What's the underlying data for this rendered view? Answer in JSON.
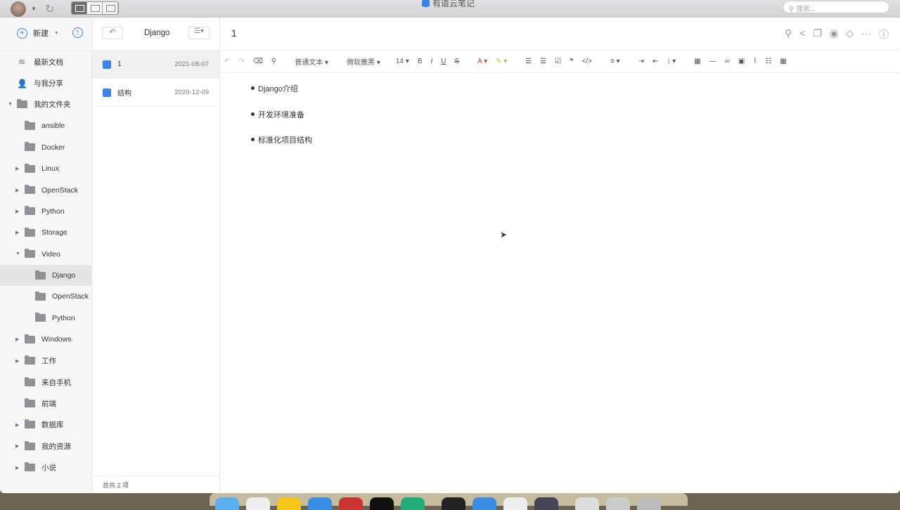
{
  "app": {
    "title": "有道云笔记",
    "search_placeholder": "搜索..."
  },
  "sidebar": {
    "new_label": "新建",
    "items": [
      {
        "label": "最新文档",
        "type": "nav",
        "icon": "layers-icon"
      },
      {
        "label": "与我分享",
        "type": "nav",
        "icon": "share-user-icon"
      },
      {
        "label": "我的文件夹",
        "type": "root",
        "expanded": true
      },
      {
        "label": "ansible",
        "level": 1
      },
      {
        "label": "Docker",
        "level": 1
      },
      {
        "label": "Linux",
        "level": 1,
        "collapsible": true
      },
      {
        "label": "OpenStack",
        "level": 1,
        "collapsible": true
      },
      {
        "label": "Python",
        "level": 1,
        "collapsible": true
      },
      {
        "label": "Storage",
        "level": 1,
        "collapsible": true
      },
      {
        "label": "Video",
        "level": 1,
        "expanded": true
      },
      {
        "label": "Django",
        "level": 2,
        "selected": true
      },
      {
        "label": "OpenStack",
        "level": 2
      },
      {
        "label": "Python",
        "level": 2
      },
      {
        "label": "Windows",
        "level": 1,
        "collapsible": true
      },
      {
        "label": "工作",
        "level": 1,
        "collapsible": true
      },
      {
        "label": "来自手机",
        "level": 1
      },
      {
        "label": "前端",
        "level": 1
      },
      {
        "label": "数据库",
        "level": 1,
        "collapsible": true
      },
      {
        "label": "我的资源",
        "level": 1,
        "collapsible": true
      },
      {
        "label": "小说",
        "level": 1,
        "collapsible": true
      }
    ]
  },
  "notes": {
    "folder": "Django",
    "items": [
      {
        "title": "1",
        "date": "2021-08-07"
      },
      {
        "title": "结构",
        "date": "2020-12-09"
      }
    ],
    "footer": "总共 2 项"
  },
  "editor": {
    "title": "1",
    "toolbar": {
      "para": "普通文本",
      "font": "微软雅黑",
      "size": "14"
    },
    "bullets": [
      "Django介绍",
      "开发环境准备",
      "标准化项目结构"
    ]
  }
}
